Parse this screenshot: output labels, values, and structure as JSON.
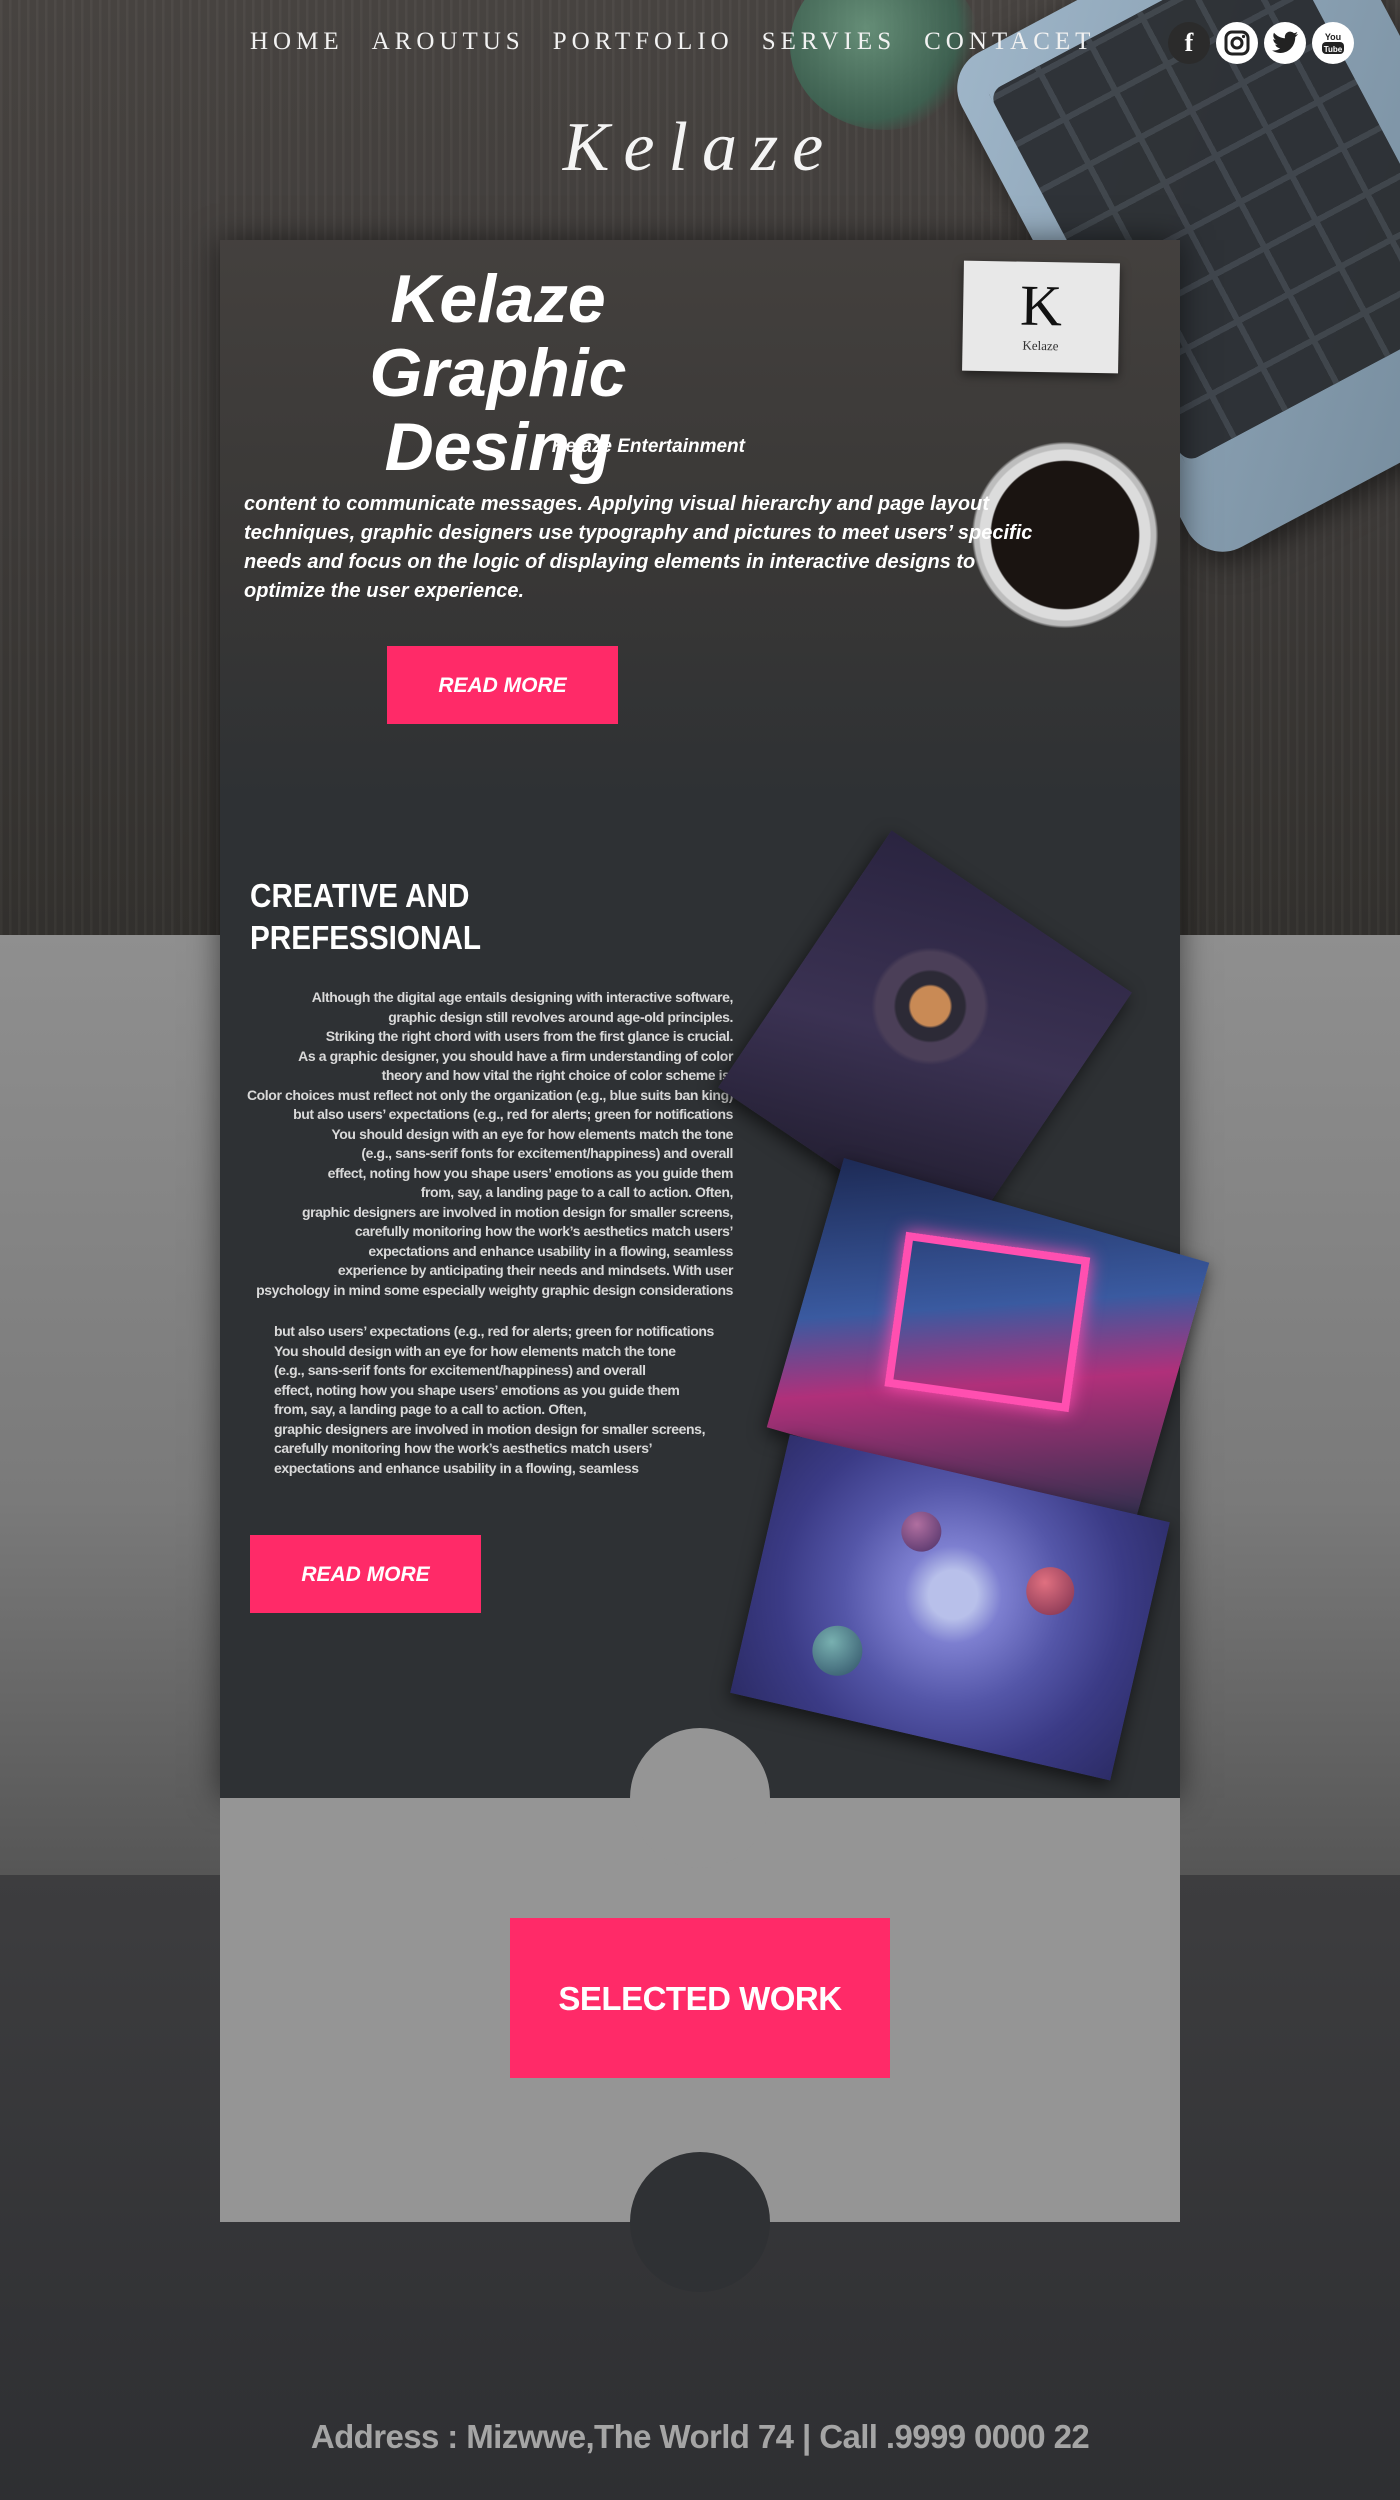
{
  "nav": {
    "items": [
      "HOME",
      "AROUTUS",
      "PORTFOLIO",
      "SERVIES",
      "CONTACET"
    ],
    "social": [
      {
        "icon": "facebook-icon",
        "glyph": "f"
      },
      {
        "icon": "instagram-icon",
        "glyph": "◎"
      },
      {
        "icon": "twitter-icon",
        "glyph": "🐦"
      },
      {
        "icon": "youtube-icon",
        "glyph": "You Tube"
      }
    ]
  },
  "brand": {
    "logo": "Kelaze"
  },
  "hero": {
    "title_line1": "Kelaze",
    "title_line2": "Graphic Desing",
    "subtitle": "Kelaze Entertainment",
    "text": "content to communicate messages. Applying visual hierarchy and page layout techniques, graphic designers use typography and pictures to meet users’ specific needs and focus on the logic of displaying elements in interactive designs to optimize the user experience.",
    "button": "READ MORE",
    "card_letter": "K",
    "card_name": "Kelaze"
  },
  "section": {
    "title_line1": "CREATIVE AND",
    "title_line2": "PREFESSIONAL",
    "para1": [
      "Although the digital age entails designing with interactive software,",
      "graphic design still revolves around age-old principles.",
      "Striking the right chord with users from the first glance is crucial.",
      "As a graphic designer, you should have a firm understanding of color",
      "theory and how vital the right choice of color scheme is.",
      "Color choices must reflect not only the organization (e.g., blue suits ban king)",
      "but also users’ expectations (e.g., red for alerts; green for notifications",
      "You should design with an eye for how elements match the tone",
      "(e.g., sans-serif fonts for excitement/happiness) and overall",
      "effect, noting how you shape users’ emotions as you guide them",
      "from, say, a landing page to a call to action. Often,",
      "graphic designers are involved in motion design for smaller screens,",
      "carefully monitoring how the work’s aesthetics match users’",
      "expectations and enhance usability in a flowing, seamless",
      "experience by anticipating their needs and mindsets. With user",
      "psychology in mind some especially weighty graphic design considerations"
    ],
    "para2": [
      "but also users’ expectations (e.g., red for alerts; green for notifications",
      "You should design with an eye for how elements match the tone",
      "(e.g., sans-serif fonts for excitement/happiness) and overall",
      "effect, noting how you shape users’ emotions as you guide them",
      "from, say, a landing page to a call to action. Often,",
      "graphic designers are involved in motion design for smaller screens,",
      "carefully monitoring how the work’s aesthetics match users’",
      " expectations and enhance usability in a flowing, seamless"
    ],
    "button": "READ MORE"
  },
  "selected_work": {
    "button": "SELECTED WORK"
  },
  "footer": {
    "text": "Address : Mizwwe,The World 74  | Call .9999 0000 22"
  },
  "colors": {
    "accent": "#ff2a68",
    "card": "#2e3134",
    "band": "#959595"
  }
}
